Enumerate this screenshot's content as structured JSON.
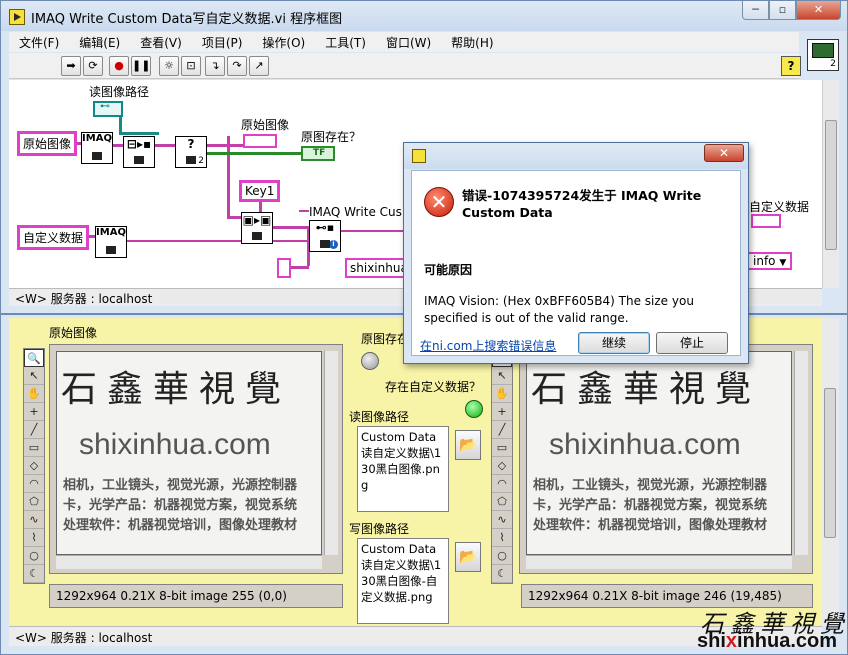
{
  "bd_window": {
    "title": "IMAQ Write Custom Data写自定义数据.vi 程序框图",
    "menu": [
      "文件(F)",
      "编辑(E)",
      "查看(V)",
      "项目(P)",
      "操作(O)",
      "工具(T)",
      "窗口(W)",
      "帮助(H)"
    ],
    "vi_icon_num": "2",
    "help_label": "?",
    "status": "<W> 服务器 : localhost"
  },
  "diagram": {
    "read_path_label": "读图像路径",
    "orig_image_ctrl": "原始图像",
    "custom_data_ctrl": "自定义数据",
    "orig_image_ind_label": "原始图像",
    "orig_exists_label": "原图存在？",
    "tf_label": "TF",
    "key_label": "Key1",
    "write_custom_label": "IMAQ Write Cus",
    "shixinhua_str": "shixinhua",
    "custom_data_ind_label": "自定义数据",
    "info_enum": "info",
    "imaq_label": "IMAQ",
    "node_q_label": "?",
    "node_q_num": "2"
  },
  "front_panel": {
    "orig_image_label": "原始图像",
    "orig_exists_label": "原图存在",
    "custom_exists_label": "存在自定义数据？",
    "read_path_label": "读图像路径",
    "read_path_value": "Custom Data读自定义数据\\130黑白图像.png",
    "write_path_label": "写图像路径",
    "write_path_value": "Custom Data读自定义数据\\130黑白图像-自定义数据.png",
    "left_info": "1292x964 0.21X 8-bit image 255      (0,0)",
    "right_info": "1292x964 0.21X 8-bit image 246      (19,485)",
    "status": "<W> 服务器 : localhost",
    "cal_text": "石鑫華視覺",
    "url_text": "shixinhua.com",
    "cn_line1": "相机，工业镜头，视觉光源，光源控制器",
    "cn_line2": "卡，光学产品：机器视觉方案，视觉系统",
    "cn_line3": "处理软件：机器视觉培训，图像处理教材"
  },
  "error_dialog": {
    "heading": "错误-1074395724发生于 IMAQ Write Custom Data",
    "possible_cause": "可能原因",
    "message": "IMAQ Vision:  (Hex 0xBFF605B4) The size you specified is out of the valid range.",
    "link": "在ni.com上搜索错误信息",
    "continue_btn": "继续",
    "stop_btn": "停止",
    "close_label": "✕"
  },
  "watermark": {
    "cal": "石鑫華視覺",
    "url_prefix": "shi",
    "url_mid": "x",
    "url_suffix": "inhua.com"
  },
  "colors": {
    "pink_wire": "#c040a8",
    "teal_path": "#0f8a88",
    "green_bool": "#2a8a2a",
    "fp_bg": "#f7f4a8"
  }
}
